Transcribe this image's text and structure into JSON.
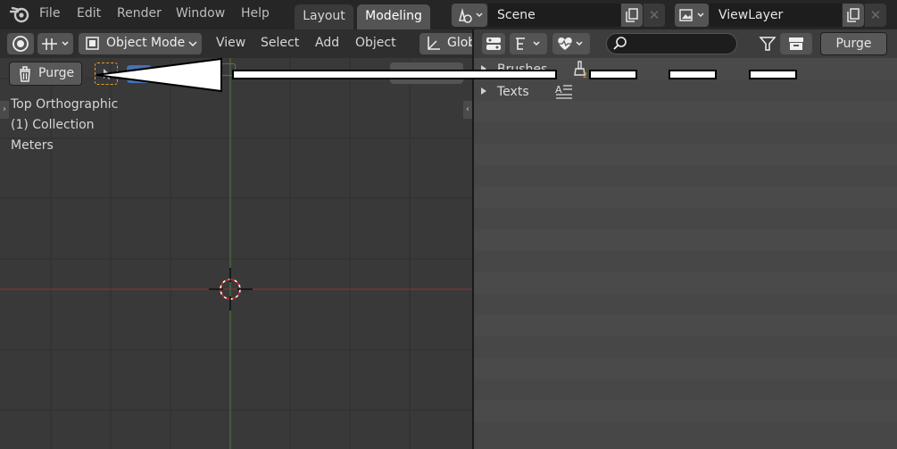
{
  "topbar": {
    "menus": [
      "File",
      "Edit",
      "Render",
      "Window",
      "Help"
    ],
    "workspace_tabs": [
      {
        "label": "Layout",
        "active": false
      },
      {
        "label": "Modeling",
        "active": true
      }
    ],
    "scene_name": "Scene",
    "view_layer_name": "ViewLayer"
  },
  "viewport_header": {
    "mode_label": "Object Mode",
    "menus": [
      "View",
      "Select",
      "Add",
      "Object"
    ],
    "orientation_label": "Glob"
  },
  "viewport_overlay": {
    "purge_label": "Purge",
    "view_name": "Top Orthographic",
    "collection": "(1) Collection",
    "units": "Meters"
  },
  "outliner": {
    "purge_label": "Purge",
    "tree_items": [
      {
        "label": "Brushes",
        "icon": "brush-icon"
      },
      {
        "label": "Texts",
        "icon": "text-icon"
      }
    ]
  },
  "colors": {
    "accent_blue": "#4772b3",
    "active_orange": "#e89b2a",
    "x_axis": "#a33b3b",
    "y_axis": "#5b8c3a"
  }
}
